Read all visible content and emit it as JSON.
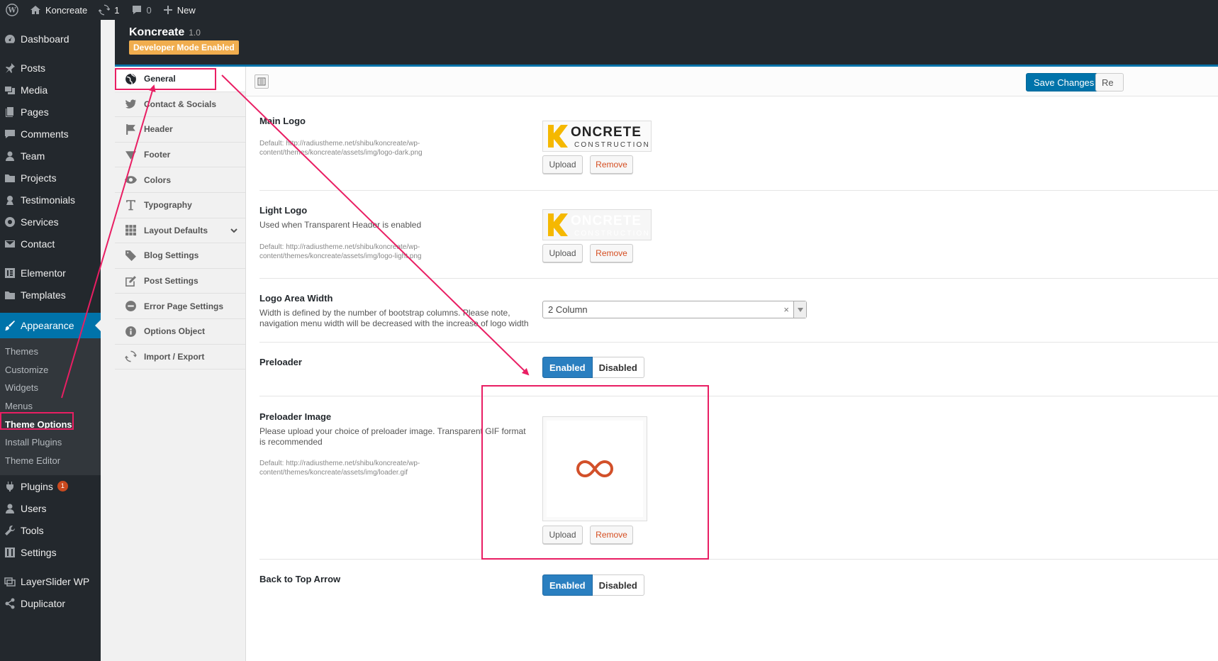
{
  "adminbar": {
    "site_name": "Koncreate",
    "updates_count": "1",
    "comments_count": "0",
    "new_label": "New"
  },
  "menu": {
    "items": [
      {
        "label": "Dashboard",
        "icon": "dashboard-icon"
      },
      {
        "label": "Posts",
        "icon": "pin-icon"
      },
      {
        "label": "Media",
        "icon": "media-icon"
      },
      {
        "label": "Pages",
        "icon": "pages-icon"
      },
      {
        "label": "Comments",
        "icon": "comment-icon"
      },
      {
        "label": "Team",
        "icon": "user-icon"
      },
      {
        "label": "Projects",
        "icon": "folder-icon"
      },
      {
        "label": "Testimonials",
        "icon": "testimonial-icon"
      },
      {
        "label": "Services",
        "icon": "services-icon"
      },
      {
        "label": "Contact",
        "icon": "mail-icon"
      },
      {
        "label": "Elementor",
        "icon": "elementor-icon"
      },
      {
        "label": "Templates",
        "icon": "folder-icon"
      },
      {
        "label": "Appearance",
        "icon": "brush-icon"
      },
      {
        "label": "Plugins",
        "icon": "plug-icon",
        "badge": "1"
      },
      {
        "label": "Users",
        "icon": "user-icon"
      },
      {
        "label": "Tools",
        "icon": "wrench-icon"
      },
      {
        "label": "Settings",
        "icon": "settings-icon"
      },
      {
        "label": "LayerSlider WP",
        "icon": "layers-icon"
      },
      {
        "label": "Duplicator",
        "icon": "share-icon"
      }
    ],
    "appearance_sub": [
      "Themes",
      "Customize",
      "Widgets",
      "Menus",
      "Theme Options",
      "Install Plugins",
      "Theme Editor"
    ]
  },
  "header": {
    "title": "Koncreate",
    "version": "1.0",
    "dev_mode": "Developer Mode Enabled"
  },
  "tabs": [
    "General",
    "Contact & Socials",
    "Header",
    "Footer",
    "Colors",
    "Typography",
    "Layout Defaults",
    "Blog Settings",
    "Post Settings",
    "Error Page Settings",
    "Options Object",
    "Import / Export"
  ],
  "toolbar": {
    "save_label": "Save Changes",
    "reset_label": "Re"
  },
  "options": {
    "main_logo": {
      "title": "Main Logo",
      "desc": "Default: http://radiustheme.net/shibu/koncreate/wp-content/themes/koncreate/assets/img/logo-dark.png",
      "upload": "Upload",
      "remove": "Remove"
    },
    "light_logo": {
      "title": "Light Logo",
      "subtitle": "Used when Transparent Header is enabled",
      "desc": "Default: http://radiustheme.net/shibu/koncreate/wp-content/themes/koncreate/assets/img/logo-light.png",
      "upload": "Upload",
      "remove": "Remove"
    },
    "logo_width": {
      "title": "Logo Area Width",
      "subtitle": "Width is defined by the number of bootstrap columns. Please note, navigation menu width will be decreased with the increase of logo width",
      "value": "2 Column"
    },
    "preloader": {
      "title": "Preloader",
      "on": "Enabled",
      "off": "Disabled"
    },
    "preloader_image": {
      "title": "Preloader Image",
      "subtitle": "Please upload your choice of preloader image. Transparent GIF format is recommended",
      "desc": "Default: http://radiustheme.net/shibu/koncreate/wp-content/themes/koncreate/assets/img/loader.gif",
      "upload": "Upload",
      "remove": "Remove"
    },
    "back_to_top": {
      "title": "Back to Top Arrow",
      "on": "Enabled",
      "off": "Disabled"
    }
  },
  "logo": {
    "k": "K",
    "name": "ONCRETE",
    "tagline": "CONSTRUCTION",
    "k_color": "#f5b800",
    "text_color": "#222222"
  },
  "colors": {
    "accent": "#0073aa",
    "annotation": "#e91e63",
    "loader": "#d2502a"
  }
}
